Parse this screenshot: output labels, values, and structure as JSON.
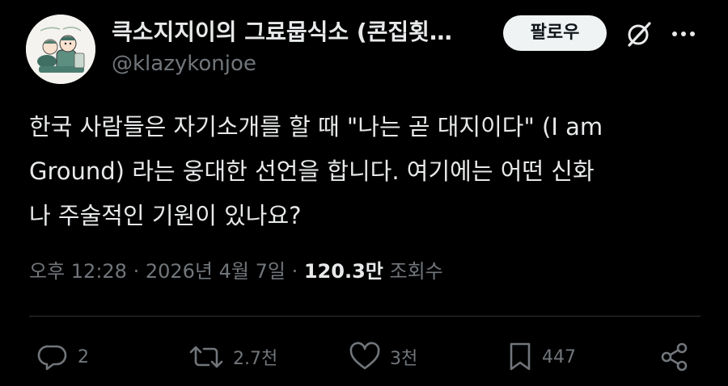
{
  "author": {
    "display_name": "큭소지지이의 그료뭅식소 (콘집횟…",
    "handle": "@klazykonjoe"
  },
  "header": {
    "follow_label": "팔로우"
  },
  "tweet": {
    "text": "한국 사람들은 자기소개를 할 때 \"나는 곧 대지이다\" (I am\nGround) 라는 웅대한 선언을 합니다. 여기에는 어떤 신화\n나 주술적인 기원이 있나요?"
  },
  "meta": {
    "time": "오후 12:28",
    "separator1": " · ",
    "date": "2026년 4월 7일",
    "separator2": " · ",
    "views_count": "120.3만",
    "views_label": " 조회수"
  },
  "actions": {
    "reply_count": "2",
    "repost_count": "2.7천",
    "like_count": "3천",
    "bookmark_count": "447"
  },
  "icons": {
    "avatar": "avatar-illustration",
    "grok": "grok-icon",
    "more": "more-icon",
    "reply": "reply-icon",
    "repost": "repost-icon",
    "like": "heart-icon",
    "bookmark": "bookmark-icon",
    "share": "share-icon"
  },
  "colors": {
    "background": "#000000",
    "text_primary": "#e7e9ea",
    "text_secondary": "#71767b",
    "follow_button_bg": "#eff3f4",
    "divider": "#2f3336"
  }
}
